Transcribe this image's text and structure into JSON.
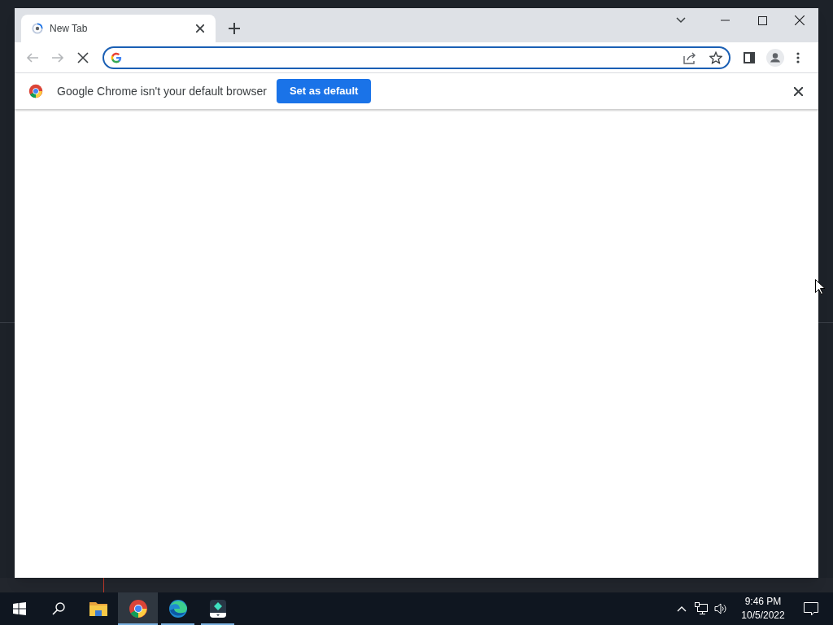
{
  "browser": {
    "tabs": [
      {
        "title": "New Tab",
        "selected": true
      }
    ],
    "nav_buttons": [
      {
        "kind": "back",
        "disabled": true
      },
      {
        "kind": "forward",
        "disabled": true
      },
      {
        "kind": "stop",
        "disabled": false
      }
    ],
    "infobar": {
      "message": "Google Chrome isn't your default browser",
      "button": "Set as default"
    }
  },
  "taskbar": {
    "apps": [
      {
        "kind": "explorer",
        "selected": false,
        "running": false
      },
      {
        "kind": "chrome",
        "selected": true,
        "running": true
      },
      {
        "kind": "edge",
        "selected": false,
        "running": true
      },
      {
        "kind": "editor",
        "selected": false,
        "running": true
      }
    ],
    "clock": {
      "time": "9:46 PM",
      "date": "10/5/2022"
    }
  }
}
